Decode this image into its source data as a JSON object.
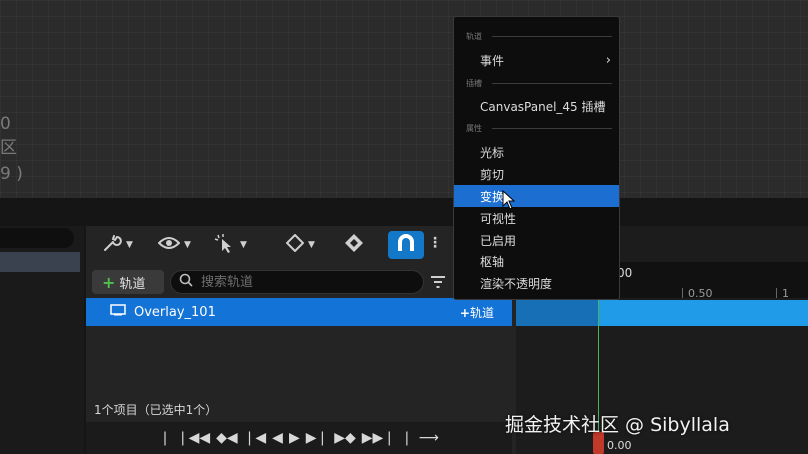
{
  "canvas": {
    "lines": [
      "0",
      "区",
      "9 )"
    ]
  },
  "toolbar": {
    "icons": [
      "wrench-icon",
      "eye-icon",
      "pointer-sparkle-icon",
      "diamond-icon",
      "keyframe-icon",
      "magnet-icon"
    ]
  },
  "track_list": {
    "add_track_label": "轨道",
    "search_placeholder": "搜索轨道",
    "tracks": [
      {
        "name": "Overlay_101",
        "add_label": "轨道"
      }
    ],
    "status": "1个项目（已选中1个）"
  },
  "timeline": {
    "ruler_top": "00",
    "ruler_mid": "0.50",
    "ruler_right": "1",
    "playhead_time": "0.00",
    "accent": "#1f9be8",
    "playhead_color": "#4db35a"
  },
  "context_menu": {
    "sections": [
      {
        "header": "轨道",
        "items": [
          {
            "label": "事件",
            "has_submenu": true
          }
        ]
      },
      {
        "header": "插槽",
        "items": [
          {
            "label": "CanvasPanel_45 插槽",
            "has_submenu": false
          }
        ]
      },
      {
        "header": "属性",
        "items": [
          {
            "label": "光标",
            "has_submenu": false
          },
          {
            "label": "剪切",
            "has_submenu": false
          },
          {
            "label": "变换",
            "has_submenu": false,
            "highlighted": true
          },
          {
            "label": "可视性",
            "has_submenu": false
          },
          {
            "label": "已启用",
            "has_submenu": false
          },
          {
            "label": "枢轴",
            "has_submenu": false
          },
          {
            "label": "渲染不透明度",
            "has_submenu": false
          }
        ]
      }
    ],
    "highlight_color": "#1c6fd1"
  },
  "watermark": "掘金技术社区 @ Sibyllala"
}
